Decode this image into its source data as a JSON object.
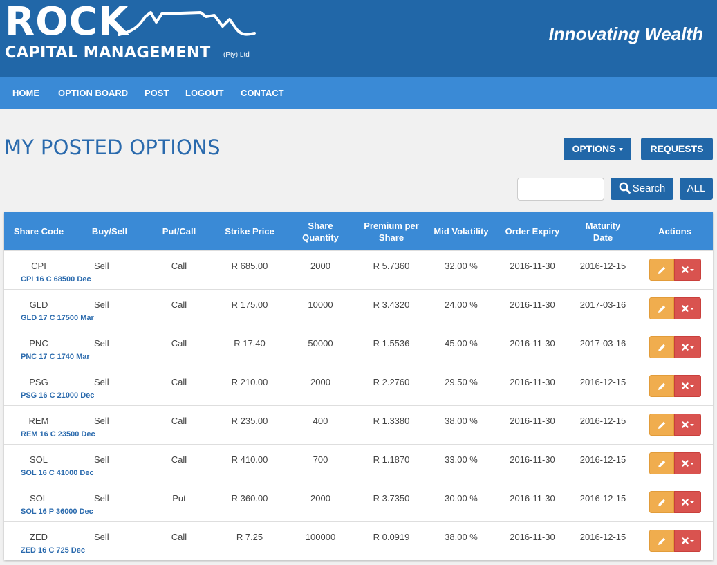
{
  "brand": {
    "rock": "ROCK",
    "capital": "CAPITAL MANAGEMENT",
    "pty": "(Pty) Ltd",
    "tagline": "Innovating Wealth"
  },
  "nav": [
    "HOME",
    "OPTION BOARD",
    "POST",
    "LOGOUT",
    "CONTACT"
  ],
  "page": {
    "title": "MY POSTED OPTIONS",
    "options_label": "OPTIONS",
    "requests_label": "REQUESTS",
    "search_value": "",
    "search_label": "Search",
    "all_label": "ALL"
  },
  "table": {
    "headers": [
      "Share Code",
      "Buy/Sell",
      "Put/Call",
      "Strike Price",
      "Share Quantity",
      "Premium per Share",
      "Mid Volatility",
      "Order Expiry",
      "Maturity Date",
      "Actions"
    ],
    "rows": [
      {
        "code": "CPI",
        "sub": "CPI 16 C 68500 Dec",
        "side": "Sell",
        "type": "Call",
        "strike": "R 685.00",
        "qty": "2000",
        "premium": "R 5.7360",
        "vol": "32.00 %",
        "expiry": "2016-11-30",
        "maturity": "2016-12-15"
      },
      {
        "code": "GLD",
        "sub": "GLD 17 C 17500 Mar",
        "side": "Sell",
        "type": "Call",
        "strike": "R 175.00",
        "qty": "10000",
        "premium": "R 3.4320",
        "vol": "24.00 %",
        "expiry": "2016-11-30",
        "maturity": "2017-03-16"
      },
      {
        "code": "PNC",
        "sub": "PNC 17 C 1740 Mar",
        "side": "Sell",
        "type": "Call",
        "strike": "R 17.40",
        "qty": "50000",
        "premium": "R 1.5536",
        "vol": "45.00 %",
        "expiry": "2016-11-30",
        "maturity": "2017-03-16"
      },
      {
        "code": "PSG",
        "sub": "PSG 16 C 21000 Dec",
        "side": "Sell",
        "type": "Call",
        "strike": "R 210.00",
        "qty": "2000",
        "premium": "R 2.2760",
        "vol": "29.50 %",
        "expiry": "2016-11-30",
        "maturity": "2016-12-15"
      },
      {
        "code": "REM",
        "sub": "REM 16 C 23500 Dec",
        "side": "Sell",
        "type": "Call",
        "strike": "R 235.00",
        "qty": "400",
        "premium": "R 1.3380",
        "vol": "38.00 %",
        "expiry": "2016-11-30",
        "maturity": "2016-12-15"
      },
      {
        "code": "SOL",
        "sub": "SOL 16 C 41000 Dec",
        "side": "Sell",
        "type": "Call",
        "strike": "R 410.00",
        "qty": "700",
        "premium": "R 1.1870",
        "vol": "33.00 %",
        "expiry": "2016-11-30",
        "maturity": "2016-12-15"
      },
      {
        "code": "SOL",
        "sub": "SOL 16 P 36000 Dec",
        "side": "Sell",
        "type": "Put",
        "strike": "R 360.00",
        "qty": "2000",
        "premium": "R 3.7350",
        "vol": "30.00 %",
        "expiry": "2016-11-30",
        "maturity": "2016-12-15"
      },
      {
        "code": "ZED",
        "sub": "ZED 16 C 725 Dec",
        "side": "Sell",
        "type": "Call",
        "strike": "R 7.25",
        "qty": "100000",
        "premium": "R 0.0919",
        "vol": "38.00 %",
        "expiry": "2016-11-30",
        "maturity": "2016-12-15"
      }
    ]
  },
  "icons": {
    "edit": "pencil-icon",
    "delete": "times-icon",
    "search": "search-icon"
  },
  "colors": {
    "header": "#2167a8",
    "nav": "#3a8ad6",
    "title": "#2a6aad",
    "edit": "#f0ad4e",
    "delete": "#d9534f"
  }
}
